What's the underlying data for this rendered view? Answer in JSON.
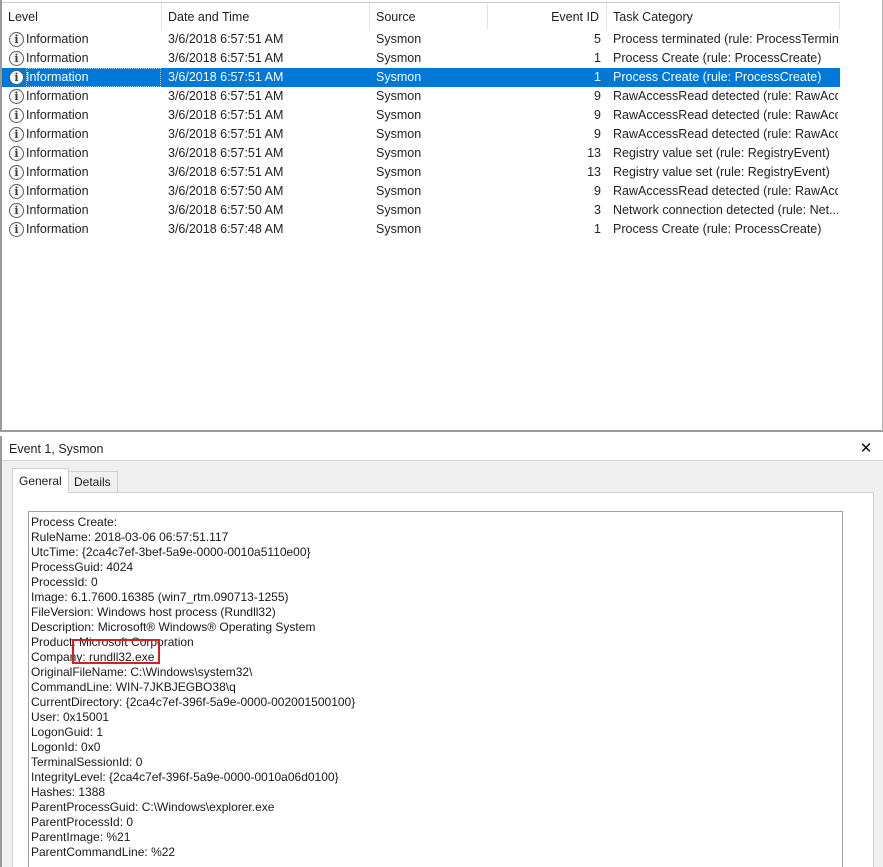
{
  "columns": {
    "level": "Level",
    "date": "Date and Time",
    "source": "Source",
    "event_id": "Event ID",
    "task": "Task Category"
  },
  "events": [
    {
      "level": "Information",
      "date": "3/6/2018 6:57:51 AM",
      "source": "Sysmon",
      "event_id": "5",
      "task": "Process terminated (rule: ProcessTermin...",
      "selected": false
    },
    {
      "level": "Information",
      "date": "3/6/2018 6:57:51 AM",
      "source": "Sysmon",
      "event_id": "1",
      "task": "Process Create (rule: ProcessCreate)",
      "selected": false
    },
    {
      "level": "Information",
      "date": "3/6/2018 6:57:51 AM",
      "source": "Sysmon",
      "event_id": "1",
      "task": "Process Create (rule: ProcessCreate)",
      "selected": true
    },
    {
      "level": "Information",
      "date": "3/6/2018 6:57:51 AM",
      "source": "Sysmon",
      "event_id": "9",
      "task": "RawAccessRead detected (rule: RawAcc...",
      "selected": false
    },
    {
      "level": "Information",
      "date": "3/6/2018 6:57:51 AM",
      "source": "Sysmon",
      "event_id": "9",
      "task": "RawAccessRead detected (rule: RawAcc...",
      "selected": false
    },
    {
      "level": "Information",
      "date": "3/6/2018 6:57:51 AM",
      "source": "Sysmon",
      "event_id": "9",
      "task": "RawAccessRead detected (rule: RawAcc...",
      "selected": false
    },
    {
      "level": "Information",
      "date": "3/6/2018 6:57:51 AM",
      "source": "Sysmon",
      "event_id": "13",
      "task": "Registry value set (rule: RegistryEvent)",
      "selected": false
    },
    {
      "level": "Information",
      "date": "3/6/2018 6:57:51 AM",
      "source": "Sysmon",
      "event_id": "13",
      "task": "Registry value set (rule: RegistryEvent)",
      "selected": false
    },
    {
      "level": "Information",
      "date": "3/6/2018 6:57:50 AM",
      "source": "Sysmon",
      "event_id": "9",
      "task": "RawAccessRead detected (rule: RawAcc...",
      "selected": false
    },
    {
      "level": "Information",
      "date": "3/6/2018 6:57:50 AM",
      "source": "Sysmon",
      "event_id": "3",
      "task": "Network connection detected (rule: Net...",
      "selected": false
    },
    {
      "level": "Information",
      "date": "3/6/2018 6:57:48 AM",
      "source": "Sysmon",
      "event_id": "1",
      "task": "Process Create (rule: ProcessCreate)",
      "selected": false
    }
  ],
  "level_icon": "info-icon",
  "detail": {
    "title": "Event 1, Sysmon",
    "close_glyph": "✕",
    "tabs": [
      {
        "label": "General",
        "active": true
      },
      {
        "label": "Details",
        "active": false
      }
    ],
    "description": [
      "Process Create:",
      "RuleName: 2018-03-06 06:57:51.117",
      "UtcTime: {2ca4c7ef-3bef-5a9e-0000-0010a5110e00}",
      "ProcessGuid: 4024",
      "ProcessId: 0",
      "Image: 6.1.7600.16385 (win7_rtm.090713-1255)",
      "FileVersion: Windows host process (Rundll32)",
      "Description: Microsoft® Windows® Operating System",
      "Product: Microsoft Corporation",
      "Company: rundll32.exe",
      "OriginalFileName: C:\\Windows\\system32\\",
      "CommandLine: WIN-7JKBJEGBO38\\q",
      "CurrentDirectory: {2ca4c7ef-396f-5a9e-0000-002001500100}",
      "User: 0x15001",
      "LogonGuid: 1",
      "LogonId: 0x0",
      "TerminalSessionId: 0",
      "IntegrityLevel: {2ca4c7ef-396f-5a9e-0000-0010a06d0100}",
      "Hashes: 1388",
      "ParentProcessGuid: C:\\Windows\\explorer.exe",
      "ParentProcessId: 0",
      "ParentImage: %21",
      "ParentCommandLine: %22"
    ]
  },
  "colors": {
    "selection": "#0078d7",
    "highlight": "#d42020",
    "pane_bg": "#f0f0f0"
  }
}
